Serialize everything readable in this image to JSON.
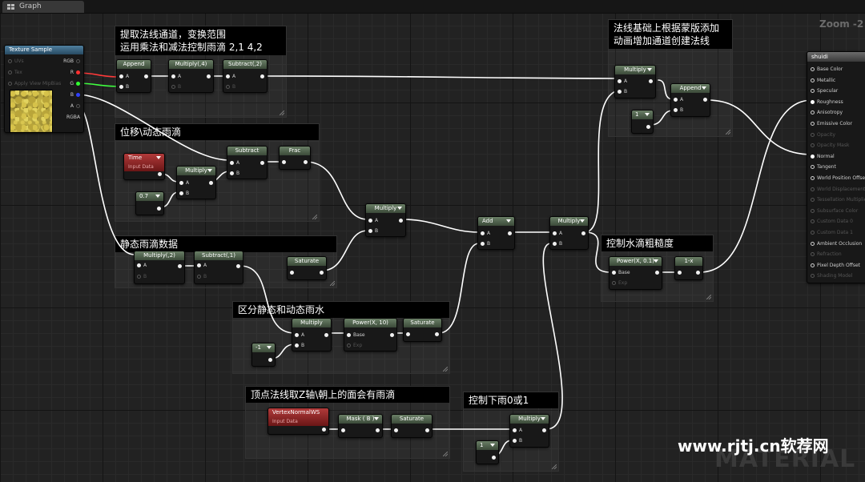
{
  "tab": {
    "label": "Graph"
  },
  "zoom": "Zoom -2",
  "watermark": "MATERIAL",
  "site": {
    "prefix": "www.rjtj.cn",
    "suffix": "软荐网"
  },
  "comments": {
    "normal": "提取法线通道，变换范围\n运用乘法和减法控制雨滴 2,1  4,2",
    "anim": "位移\\动态雨滴",
    "static": "静态雨滴数据",
    "separate": "区分静态和动态雨水",
    "top": "顶点法线取Z轴\\朝上的面会有雨滴",
    "rain": "控制下雨0或1",
    "mask": "法线基础上根据蒙版添加\n动画增加通道创建法线",
    "rough": "控制水滴粗糙度"
  },
  "nodes": {
    "texture": {
      "title": "Texture Sample",
      "in": [
        "UVs",
        "Tex",
        "Apply View MipBias"
      ],
      "out": [
        "RGB",
        "R",
        "G",
        "B",
        "A",
        "RGBA"
      ]
    },
    "append1": {
      "title": "Append"
    },
    "mul4": {
      "title": "Multiply(,4)"
    },
    "sub2": {
      "title": "Subtract(,2)"
    },
    "time": {
      "title": "Time",
      "sub": "Input Data"
    },
    "mulT": {
      "title": "Multiply"
    },
    "c07": {
      "value": "0.7"
    },
    "subA": {
      "title": "Subtract"
    },
    "frac": {
      "title": "Frac"
    },
    "mul2": {
      "title": "Multiply(,2)"
    },
    "sub1": {
      "title": "Subtract(,1)"
    },
    "sat1": {
      "title": "Saturate"
    },
    "mulC": {
      "title": "Multiply"
    },
    "add": {
      "title": "Add"
    },
    "mulS": {
      "title": "Multiply"
    },
    "cneg1": {
      "value": "-1"
    },
    "pow10": {
      "title": "Power(X, 10)",
      "in": [
        "Base",
        "Exp"
      ]
    },
    "sat2": {
      "title": "Saturate"
    },
    "vnws": {
      "title": "VertexNormalWS",
      "sub": "Input Data"
    },
    "maskb": {
      "title": "Mask ( B )"
    },
    "sat3": {
      "title": "Saturate"
    },
    "mulR": {
      "title": "Multiply"
    },
    "c1r": {
      "value": "1"
    },
    "mulD": {
      "title": "Multiply"
    },
    "mulM": {
      "title": "Multiply"
    },
    "c1m": {
      "value": "1"
    },
    "append2": {
      "title": "Append"
    },
    "pow01": {
      "title": "Power(X, 0.1)",
      "in": [
        "Base",
        "Exp"
      ]
    },
    "onex": {
      "title": "1-x"
    },
    "shuidi": {
      "title": "shuidi",
      "pins": [
        "Base Color",
        "Metallic",
        "Specular",
        "Roughness",
        "Anisotropy",
        "Emissive Color",
        "Opacity",
        "Opacity Mask",
        "Normal",
        "Tangent",
        "World Position Offset",
        "World Displacement",
        "Tessellation Multiplier",
        "Subsurface Color",
        "Custom Data 0",
        "Custom Data 1",
        "Ambient Occlusion",
        "Refraction",
        "Pixel Depth Offset",
        "Shading Model"
      ],
      "disabled": [
        6,
        7,
        11,
        12,
        13,
        14,
        15,
        17,
        19
      ]
    }
  },
  "pins": {
    "a": "A",
    "b": "B"
  }
}
